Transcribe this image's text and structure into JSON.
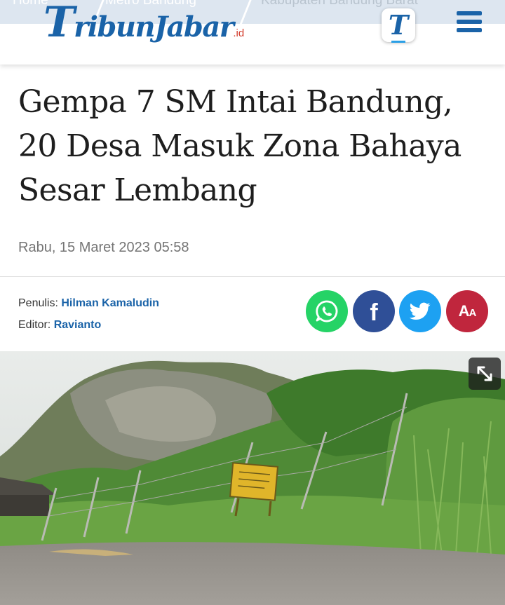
{
  "breadcrumb": [
    "Home",
    "Metro Bandung",
    "Kabupaten Bandung Barat"
  ],
  "header": {
    "logo_big": "T",
    "logo_text": "ribunJabar",
    "logo_suffix": ".id",
    "app_icon_letter": "T",
    "menu_icon": "hamburger-menu-icon"
  },
  "article": {
    "title": "Gempa 7 SM Intai Bandung, 20 Desa Masuk Zona Bahaya Sesar Lembang",
    "date": "Rabu, 15 Maret 2023 05:58"
  },
  "credits": {
    "writer_label": "Penulis:",
    "writer": "Hilman Kamaludin",
    "editor_label": "Editor:",
    "editor": "Ravianto"
  },
  "share": {
    "whatsapp_icon": "whatsapp-icon",
    "facebook_icon": "facebook-icon",
    "facebook_glyph": "f",
    "twitter_icon": "twitter-icon",
    "font_size_big": "A",
    "font_size_small": "A"
  },
  "photo": {
    "expand_icon": "expand-icon"
  },
  "colors": {
    "brand": "#1a63a8",
    "whatsapp": "#25d366",
    "facebook": "#2f4f97",
    "twitter": "#1da1f2",
    "font_size": "#c0263d"
  }
}
